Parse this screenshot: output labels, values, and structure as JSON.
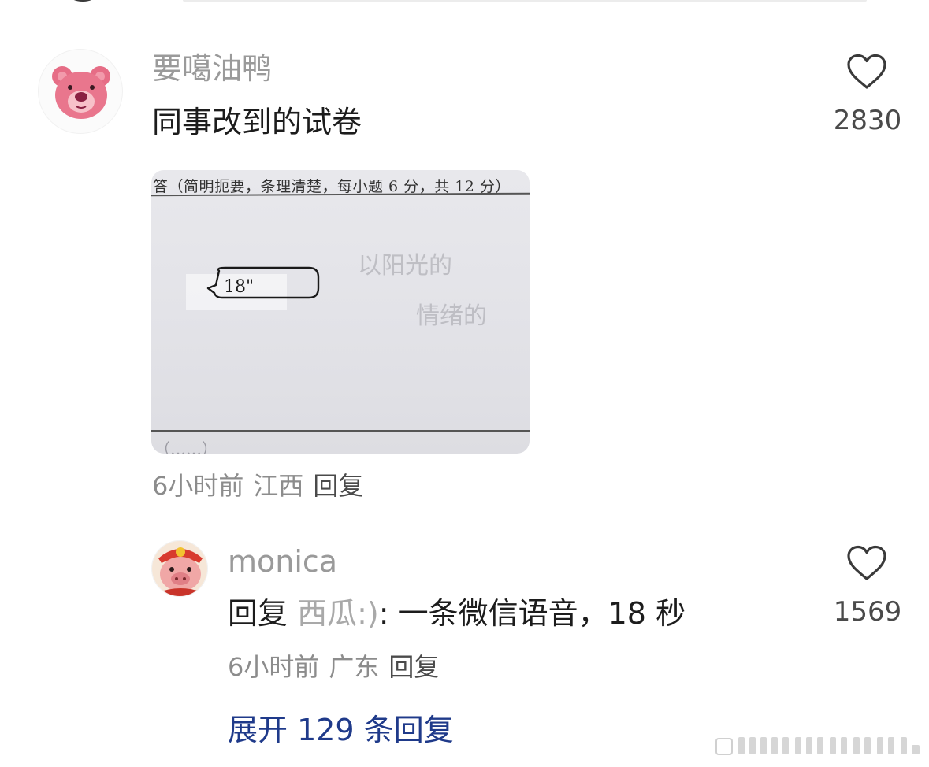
{
  "comment": {
    "username": "要噶油鸭",
    "text": "同事改到的试卷",
    "likes": "2830",
    "time": "6小时前",
    "location": "江西",
    "reply_label": "回复",
    "avatar_icon": "pink-bear-avatar"
  },
  "photo": {
    "header_text": "答（简明扼要，条理清楚，每小题 6 分，共 12 分）",
    "bubble_text": "18\"",
    "ghost_text_1": "以阳光的",
    "ghost_text_2": "情绪的",
    "bottom_text": "（……）"
  },
  "reply": {
    "username": "monica",
    "prefix": "回复",
    "target": "西瓜:)",
    "text": ": 一条微信语音，18 秒",
    "likes": "1569",
    "time": "6小时前",
    "location": "广东",
    "reply_label": "回复",
    "avatar_icon": "pig-hero-avatar"
  },
  "expand_label": "展开 129 条回复",
  "colors": {
    "username": "#9a9a9a",
    "link_blue": "#1f3a8a",
    "heart_stroke": "#3a3a3a"
  }
}
